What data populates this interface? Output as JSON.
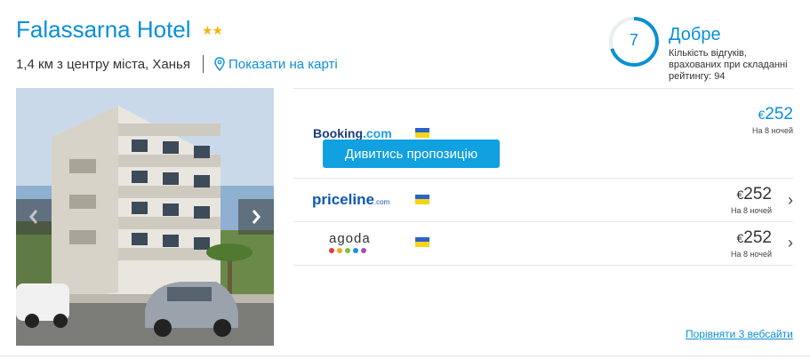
{
  "hotel": {
    "name": "Falassarna Hotel",
    "stars": "★★",
    "distance": "1,4 км з центру міста, Ханья",
    "map_link": "Показати на карті"
  },
  "rating": {
    "score": "7",
    "score_fraction": 0.7,
    "word": "Добре",
    "note": "Кількість відгуків, врахованих при складанні рейтингу: 94"
  },
  "photo": {
    "prev_icon": "chevron-left-icon",
    "next_icon": "chevron-right-icon"
  },
  "offers": [
    {
      "site": "Booking.com",
      "site_main": "Booking",
      "site_suffix": ".com",
      "price": "252",
      "currency": "€",
      "nights": "На 8 ночей",
      "button": "Дивитись пропозицію",
      "featured": true
    },
    {
      "site": "priceline.com",
      "site_main": "priceline",
      "site_suffix": ".com",
      "price": "252",
      "currency": "€",
      "nights": "На 8 ночей"
    },
    {
      "site": "agoda",
      "site_main": "agoda",
      "site_suffix": "",
      "price": "252",
      "currency": "€",
      "nights": "На 8 ночей",
      "dot_colors": [
        "#e23c35",
        "#f5a623",
        "#7ac143",
        "#1a8fe3",
        "#a34fb8"
      ]
    }
  ],
  "compare_link": "Порівняти 3 вебсайти",
  "colors": {
    "accent": "#0a8fd9",
    "button": "#11a0e0",
    "star": "#f5b40a"
  }
}
